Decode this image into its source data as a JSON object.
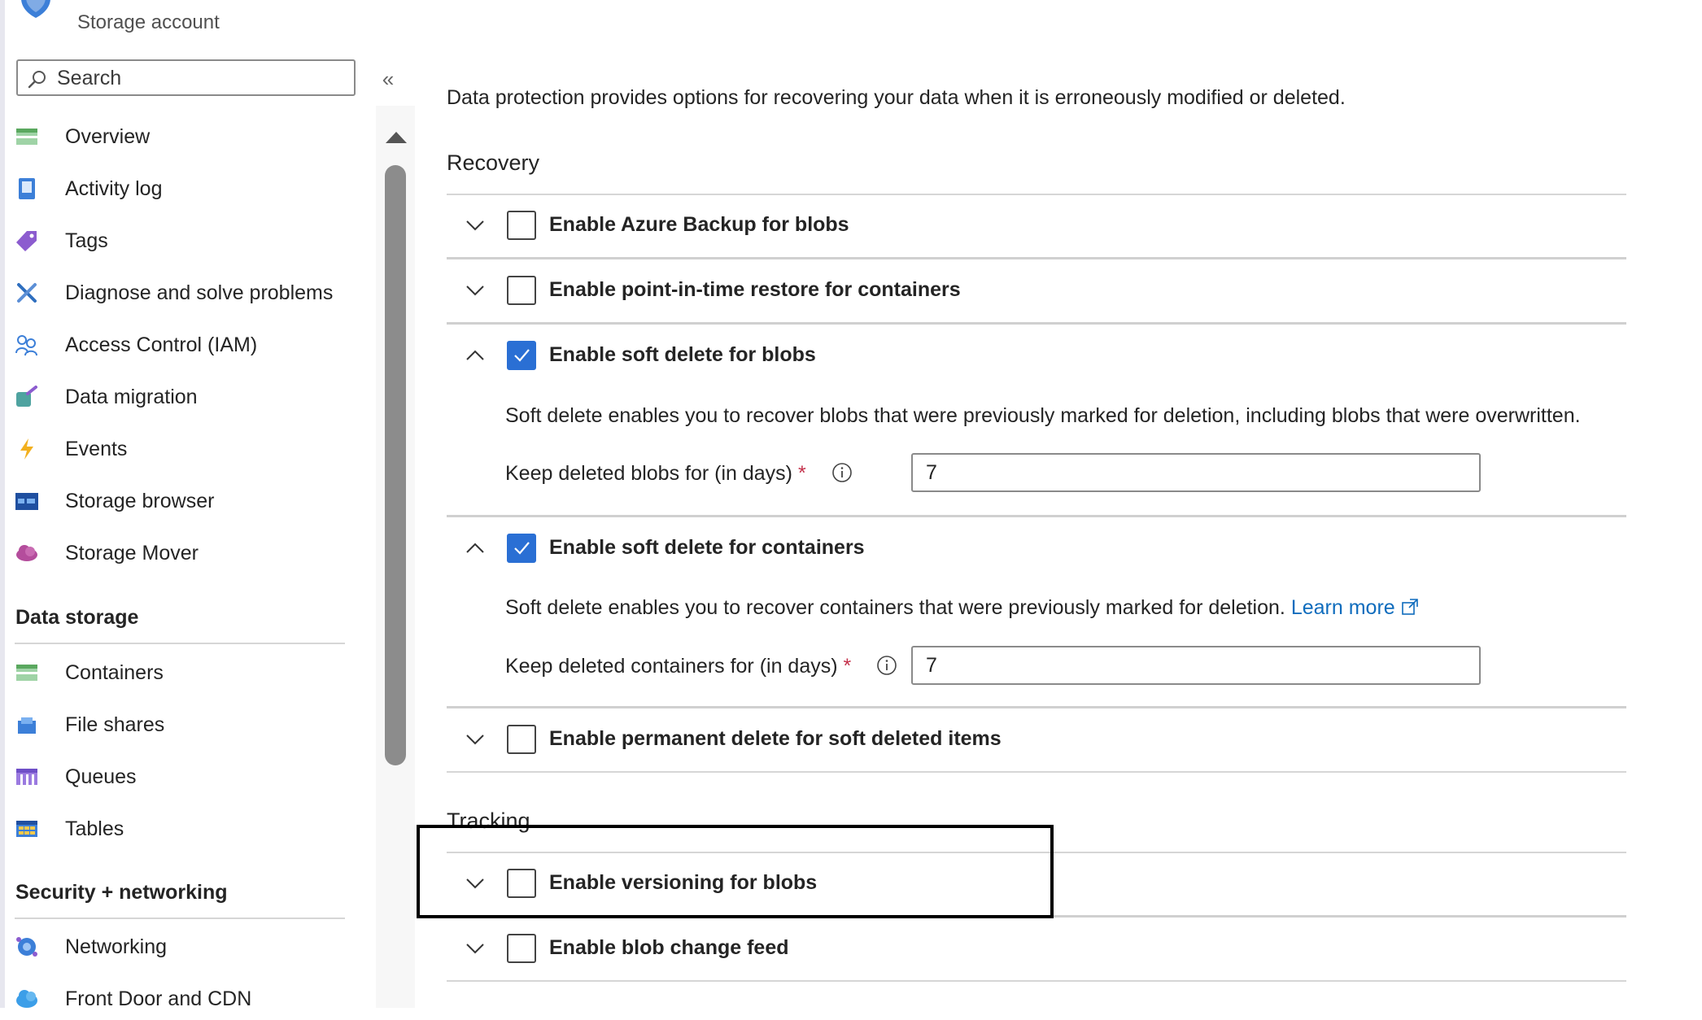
{
  "header": {
    "resource_type": "Storage account"
  },
  "search": {
    "placeholder": "Search"
  },
  "sidebar": {
    "collapse_glyph": "«",
    "items": [
      {
        "label": "Overview",
        "icon": "overview-icon"
      },
      {
        "label": "Activity log",
        "icon": "activity-log-icon"
      },
      {
        "label": "Tags",
        "icon": "tag-icon"
      },
      {
        "label": "Diagnose and solve problems",
        "icon": "wrench-icon"
      },
      {
        "label": "Access Control (IAM)",
        "icon": "people-icon"
      },
      {
        "label": "Data migration",
        "icon": "data-migration-icon"
      },
      {
        "label": "Events",
        "icon": "lightning-icon"
      },
      {
        "label": "Storage browser",
        "icon": "storage-browser-icon"
      },
      {
        "label": "Storage Mover",
        "icon": "cloud-icon"
      }
    ],
    "data_storage": {
      "title": "Data storage",
      "items": [
        {
          "label": "Containers",
          "icon": "containers-icon"
        },
        {
          "label": "File shares",
          "icon": "file-shares-icon"
        },
        {
          "label": "Queues",
          "icon": "queues-icon"
        },
        {
          "label": "Tables",
          "icon": "tables-icon"
        }
      ]
    },
    "security": {
      "title": "Security + networking",
      "items": [
        {
          "label": "Networking",
          "icon": "networking-icon"
        },
        {
          "label": "Front Door and CDN",
          "icon": "front-door-icon"
        }
      ]
    }
  },
  "main": {
    "intro": "Data protection provides options for recovering your data when it is erroneously modified or deleted.",
    "recovery": {
      "title": "Recovery",
      "azure_backup": {
        "label": "Enable Azure Backup for blobs",
        "checked": false,
        "expanded": false
      },
      "pitr": {
        "label": "Enable point-in-time restore for containers",
        "checked": false,
        "expanded": false
      },
      "soft_delete_blobs": {
        "label": "Enable soft delete for blobs",
        "checked": true,
        "expanded": true,
        "description": "Soft delete enables you to recover blobs that were previously marked for deletion, including blobs that were overwritten.",
        "field_label": "Keep deleted blobs for (in days)",
        "required_mark": "*",
        "value": "7"
      },
      "soft_delete_containers": {
        "label": "Enable soft delete for containers",
        "checked": true,
        "expanded": true,
        "description": "Soft delete enables you to recover containers that were previously marked for deletion.",
        "learn_more": "Learn more",
        "field_label": "Keep deleted containers for (in days)",
        "required_mark": "*",
        "value": "7"
      },
      "permanent_delete": {
        "label": "Enable permanent delete for soft deleted items",
        "checked": false,
        "expanded": false
      }
    },
    "tracking": {
      "title": "Tracking",
      "versioning": {
        "label": "Enable versioning for blobs",
        "checked": false,
        "expanded": false
      },
      "change_feed": {
        "label": "Enable blob change feed",
        "checked": false,
        "expanded": false
      }
    }
  },
  "colors": {
    "accent": "#2a6fd4",
    "link": "#0f6cbd",
    "required": "#c4314b"
  }
}
